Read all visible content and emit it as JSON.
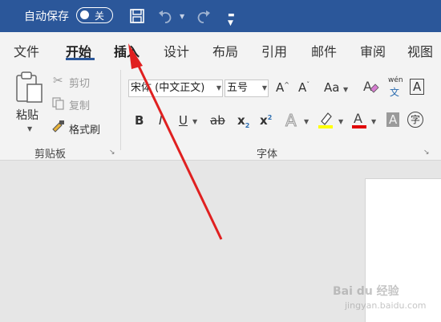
{
  "titlebar": {
    "autosave_label": "自动保存",
    "autosave_toggle": "关",
    "colors": {
      "bg": "#2b579a",
      "text": "#ffffff"
    },
    "icons": [
      "save-icon",
      "undo-icon",
      "redo-icon",
      "customize-qat-icon"
    ]
  },
  "tabs": [
    {
      "label": "文件"
    },
    {
      "label": "开始",
      "active": true
    },
    {
      "label": "插入",
      "highlighted": true
    },
    {
      "label": "设计"
    },
    {
      "label": "布局"
    },
    {
      "label": "引用"
    },
    {
      "label": "邮件"
    },
    {
      "label": "审阅"
    },
    {
      "label": "视图"
    }
  ],
  "clipboard": {
    "paste": "粘贴",
    "cut": "剪切",
    "copy": "复制",
    "format_painter": "格式刷",
    "group_label": "剪贴板"
  },
  "font": {
    "font_name": "宋体 (中文正文)",
    "font_size": "五号",
    "change_case": "Aa",
    "bold": "B",
    "italic": "I",
    "underline": "U",
    "strikethrough": "ab",
    "subscript": "x",
    "superscript": "x",
    "phonetic_top": "wén",
    "phonetic_bottom": "文",
    "encircle": "字",
    "char_border": "A",
    "group_label": "字体",
    "highlight_color": "#ffff00",
    "font_color": "#e00000"
  },
  "annotation": {
    "arrow_color": "#e02020"
  },
  "watermark": {
    "text": "Bai du 经验",
    "sub": "jingyan.baidu.com"
  }
}
